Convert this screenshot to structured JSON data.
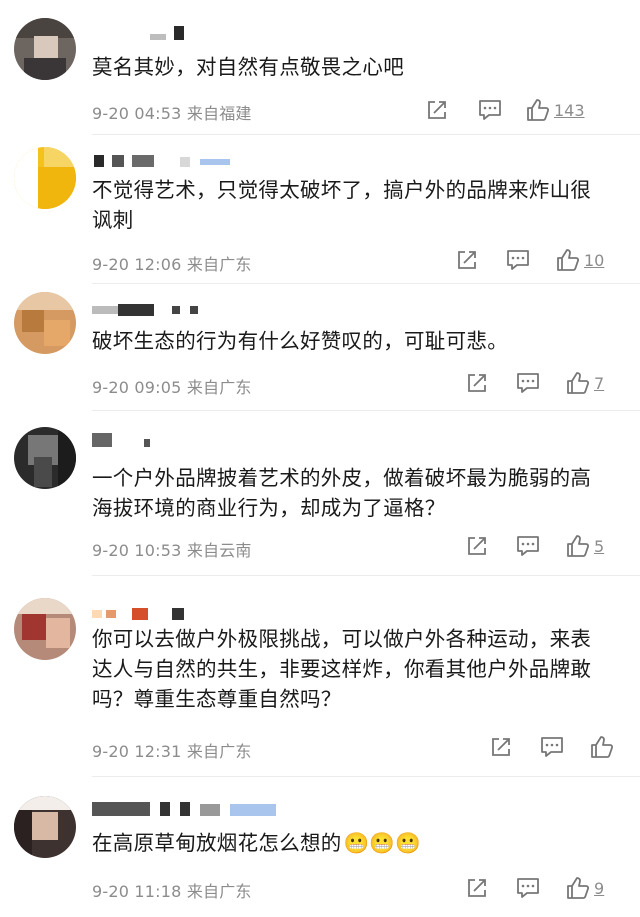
{
  "comments": [
    {
      "text": "莫名其妙，对自然有点敬畏之心吧",
      "time": "9-20 04:53",
      "location": "来自福建",
      "likes": "143",
      "share_icon": "share-icon",
      "comment_icon": "comment-icon",
      "like_icon": "thumbs-up-icon"
    },
    {
      "text": "不觉得艺术，只觉得太破坏了，搞户外的品牌来炸山很讽刺",
      "time": "9-20 12:06",
      "location": "来自广东",
      "likes": "10",
      "share_icon": "share-icon",
      "comment_icon": "comment-icon",
      "like_icon": "thumbs-up-icon"
    },
    {
      "text": "破坏生态的行为有什么好赞叹的，可耻可悲。",
      "time": "9-20 09:05",
      "location": "来自广东",
      "likes": "7",
      "share_icon": "share-icon",
      "comment_icon": "comment-icon",
      "like_icon": "thumbs-up-icon"
    },
    {
      "text": "一个户外品牌披着艺术的外皮，做着破坏最为脆弱的高海拔环境的商业行为，却成为了逼格？",
      "time": "9-20 10:53",
      "location": "来自云南",
      "likes": "5",
      "share_icon": "share-icon",
      "comment_icon": "comment-icon",
      "like_icon": "thumbs-up-icon"
    },
    {
      "text": "你可以去做户外极限挑战，可以做户外各种运动，来表达人与自然的共生，非要这样炸，你看其他户外品牌敢吗？尊重生态尊重自然吗？",
      "time": "9-20 12:31",
      "location": "来自广东",
      "likes": "",
      "share_icon": "share-icon",
      "comment_icon": "comment-icon",
      "like_icon": "thumbs-up-icon"
    },
    {
      "text": "在高原草甸放烟花怎么想的",
      "emoji": "😬😬😬",
      "time": "9-20 11:18",
      "location": "来自广东",
      "likes": "9",
      "share_icon": "share-icon",
      "comment_icon": "comment-icon",
      "like_icon": "thumbs-up-icon"
    }
  ],
  "colors": {
    "text": "#1a1a1a",
    "meta": "#8c8c8c",
    "icon": "#777777",
    "divider": "#ececec"
  }
}
